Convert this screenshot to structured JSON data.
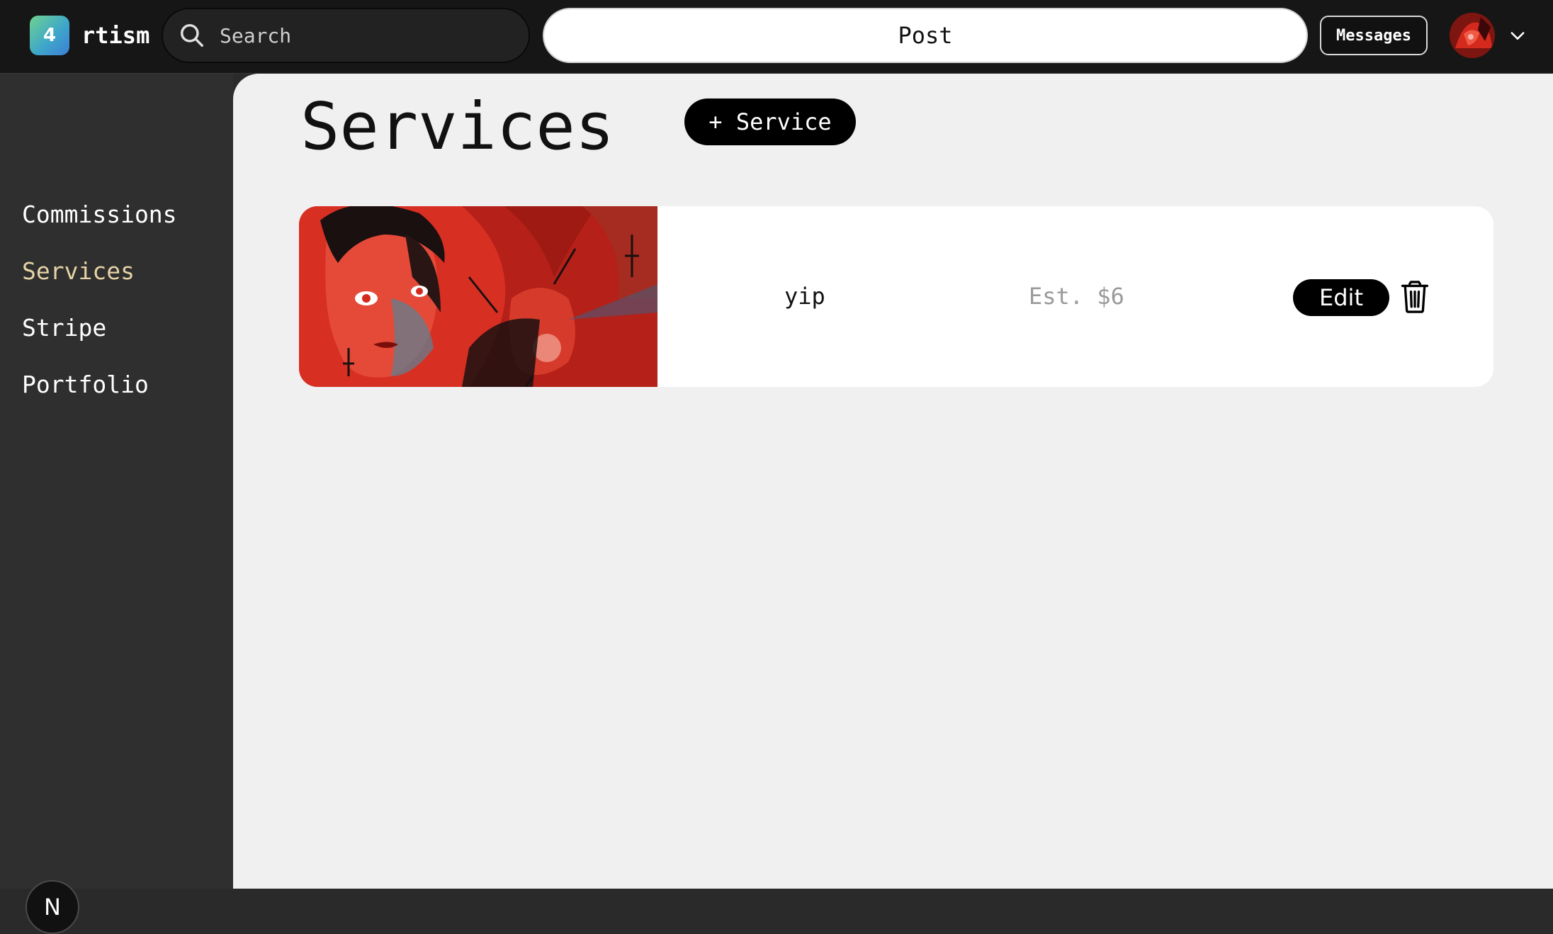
{
  "header": {
    "logo_glyph": "4",
    "logo_text": "rtism",
    "search_placeholder": "Search",
    "post_label": "Post",
    "messages_label": "Messages",
    "icons": [
      "search-icon",
      "avatar",
      "chevron-down-icon"
    ]
  },
  "sidebar": {
    "items": [
      {
        "label": "Commissions",
        "active": false
      },
      {
        "label": "Services",
        "active": true
      },
      {
        "label": "Stripe",
        "active": false
      },
      {
        "label": "Portfolio",
        "active": false
      }
    ],
    "badge": "N",
    "active_color": "#e6d3a6"
  },
  "main": {
    "title": "Services",
    "add_button_label": "+ Service",
    "services": [
      {
        "name": "yip",
        "price": "Est. $6",
        "edit_label": "Edit",
        "icons": [
          "thumbnail-artwork",
          "trash-icon"
        ]
      }
    ]
  },
  "colors": {
    "topbar_bg": "#161616",
    "sidebar_bg": "#2f2f2f",
    "main_bg": "#f0f0f0",
    "accent_black": "#000000"
  }
}
